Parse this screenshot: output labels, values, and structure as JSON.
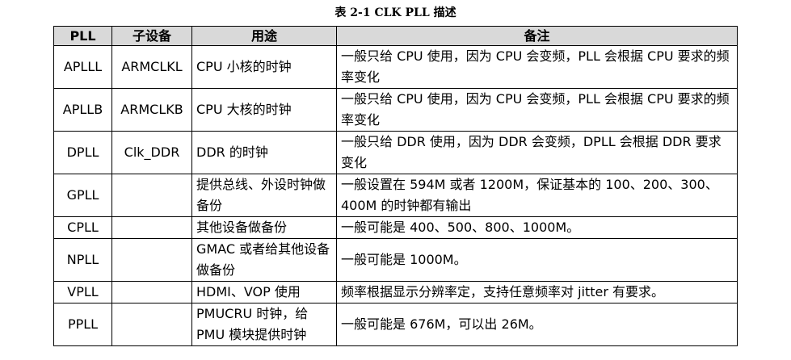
{
  "caption": "表 2-1 CLK PLL 描述",
  "headers": {
    "pll": "PLL",
    "device": "子设备",
    "purpose": "用途",
    "note": "备注"
  },
  "rows": [
    {
      "pll": "APLLL",
      "device": "ARMCLKL",
      "purpose": "CPU 小核的时钟",
      "note": "一般只给 CPU 使用，因为 CPU 会变频，PLL 会根据 CPU 要求的频率变化"
    },
    {
      "pll": "APLLB",
      "device": "ARMCLKB",
      "purpose": "CPU 大核的时钟",
      "note": "一般只给 CPU 使用，因为 CPU 会变频，PLL 会根据 CPU 要求的频率变化"
    },
    {
      "pll": "DPLL",
      "device": "Clk_DDR",
      "purpose": "DDR 的时钟",
      "note": "一般只给 DDR 使用，因为 DDR 会变频，DPLL 会根据 DDR 要求变化"
    },
    {
      "pll": "GPLL",
      "device": "",
      "purpose": "提供总线、外设时钟做备份",
      "note": "一般设置在 594M 或者 1200M，保证基本的 100、200、300、400M 的时钟都有输出"
    },
    {
      "pll": "CPLL",
      "device": "",
      "purpose": "其他设备做备份",
      "note": "一般可能是 400、500、800、1000M。"
    },
    {
      "pll": "NPLL",
      "device": "",
      "purpose": "GMAC 或者给其他设备做备份",
      "note": "一般可能是 1000M。"
    },
    {
      "pll": "VPLL",
      "device": "",
      "purpose": "HDMI、VOP 使用",
      "note": "频率根据显示分辨率定，支持任意频率对 jitter 有要求。"
    },
    {
      "pll": "PPLL",
      "device": "",
      "purpose": "PMUCRU 时钟，给 PMU 模块提供时钟",
      "note": "一般可能是 676M，可以出 26M。"
    }
  ]
}
